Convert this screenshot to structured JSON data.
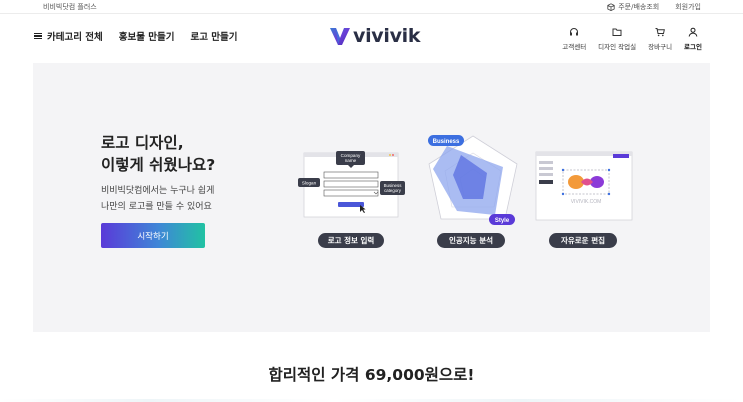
{
  "topbar": {
    "plus_label": "비비빅닷컴 플러스",
    "order_label": "주문/배송조회",
    "signup_label": "회원가입"
  },
  "nav": {
    "category_label": "카테고리 전체",
    "promo_label": "홍보물 만들기",
    "logo_make_label": "로고 만들기",
    "brand": "vivivik",
    "utilities": {
      "support": "고객센터",
      "design_room": "디자인 작업실",
      "cart": "장바구니",
      "login": "로그인"
    }
  },
  "hero": {
    "title_line1": "로고 디자인,",
    "title_line2": "이렇게 쉬웠나요?",
    "sub_line1": "비비빅닷컴에서는 누구나 쉽게",
    "sub_line2": "나만의 로고를 만들 수 있어요",
    "start_button": "시작하기",
    "steps": [
      {
        "label": "로고 정보 입력",
        "form": {
          "company_tag_line1": "Company",
          "company_tag_line2": "name",
          "slogan_tag": "Slogan",
          "business_tag_line1": "Business",
          "business_tag_line2": "category"
        }
      },
      {
        "label": "인공지능 분석",
        "radar": {
          "tag_business": "Business",
          "tag_style": "Style"
        }
      },
      {
        "label": "자유로운 편집",
        "editor": {
          "watermark": "VIVIVIK.COM"
        }
      }
    ]
  },
  "pricing": {
    "title": "합리적인 가격 69,000원으로!"
  },
  "colors": {
    "accent_purple": "#5a3ad8",
    "accent_teal": "#21c2a3",
    "hero_bg": "#f4f4f6",
    "radar_blue": "#3c6fe0"
  }
}
